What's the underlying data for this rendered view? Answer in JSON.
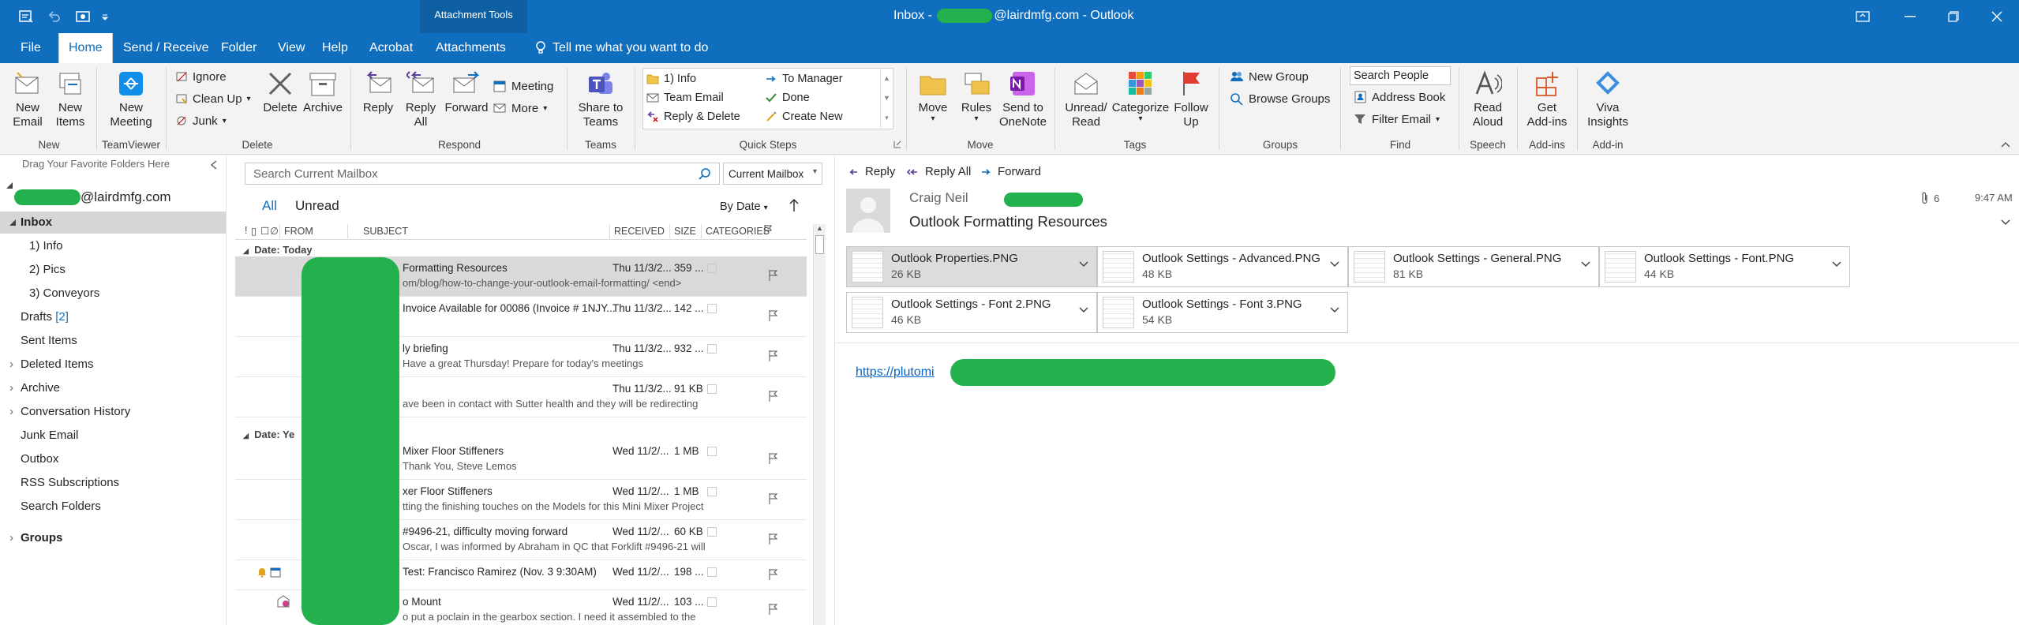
{
  "titlebar": {
    "context_tab": "Attachment Tools",
    "title_prefix": "Inbox - ",
    "title_domain": "@lairdmfg.com",
    "title_suffix": " - Outlook"
  },
  "menu": {
    "tabs": [
      "File",
      "Home",
      "Send / Receive",
      "Folder",
      "View",
      "Help",
      "Acrobat",
      "Attachments"
    ],
    "tell_me": "Tell me what you want to do"
  },
  "ribbon": {
    "new_email": [
      "New",
      "Email"
    ],
    "new_items": [
      "New",
      "Items"
    ],
    "group_new": "New",
    "new_meeting": [
      "New",
      "Meeting"
    ],
    "group_teamviewer": "TeamViewer",
    "ignore": "Ignore",
    "clean_up": "Clean Up",
    "junk": "Junk",
    "delete": "Delete",
    "archive": "Archive",
    "group_delete": "Delete",
    "reply": "Reply",
    "reply_all": [
      "Reply",
      "All"
    ],
    "forward": "Forward",
    "meeting": "Meeting",
    "more": "More",
    "group_respond": "Respond",
    "share_teams": [
      "Share to",
      "Teams"
    ],
    "group_teams": "Teams",
    "quick_steps": [
      "1) Info",
      "Team Email",
      "Reply & Delete",
      "To Manager",
      "Done",
      "Create New"
    ],
    "group_quick_steps": "Quick Steps",
    "move": "Move",
    "rules": "Rules",
    "send_onenote": [
      "Send to",
      "OneNote"
    ],
    "group_move": "Move",
    "unread_read": [
      "Unread/",
      "Read"
    ],
    "categorize": "Categorize",
    "follow_up": [
      "Follow",
      "Up"
    ],
    "group_tags": "Tags",
    "new_group": "New Group",
    "browse_groups": "Browse Groups",
    "group_groups": "Groups",
    "search_people": "Search People",
    "address_book": "Address Book",
    "filter_email": "Filter Email",
    "group_find": "Find",
    "read_aloud": [
      "Read",
      "Aloud"
    ],
    "group_speech": "Speech",
    "get_addins": [
      "Get",
      "Add-ins"
    ],
    "group_addins": "Add-ins",
    "viva": [
      "Viva",
      "Insights"
    ],
    "group_addin": "Add-in"
  },
  "folders": {
    "favorites_hint": "Drag Your Favorite Folders Here",
    "account": "@lairdmfg.com",
    "inbox": "Inbox",
    "sub": [
      "1) Info",
      "2) Pics",
      "3)  Conveyors"
    ],
    "drafts": "Drafts",
    "drafts_count": "[2]",
    "items": [
      "Sent Items",
      "Deleted Items",
      "Archive",
      "Conversation History",
      "Junk Email",
      "Outbox",
      "RSS Subscriptions",
      "Search Folders"
    ],
    "groups": "Groups"
  },
  "maillist": {
    "search_placeholder": "Search Current Mailbox",
    "scope": "Current Mailbox",
    "filter_all": "All",
    "filter_unread": "Unread",
    "sort": "By Date",
    "columns": {
      "from": "FROM",
      "subject": "SUBJECT",
      "received": "RECEIVED",
      "size": "SIZE",
      "categories": "CATEGORIES"
    },
    "group_today": "Date: Today",
    "group_yesterday": "Date: Ye",
    "today": [
      {
        "subject": "Formatting Resources",
        "preview": "om/blog/how-to-change-your-outlook-email-formatting/  <end>",
        "received": "Thu 11/3/2...",
        "size": "359 ..."
      },
      {
        "subject": "Invoice Available for 00086 (Invoice # 1NJY...",
        "preview": "",
        "received": "Thu 11/3/2...",
        "size": "142 ..."
      },
      {
        "subject": "ly briefing",
        "preview": "Have a great Thursday!   Prepare for today's meetings",
        "received": "Thu 11/3/2...",
        "size": "932 ..."
      },
      {
        "subject": "",
        "preview": "ave been in contact with Sutter health and they will be redirecting",
        "received": "Thu 11/3/2...",
        "size": "91 KB"
      }
    ],
    "yesterday": [
      {
        "subject": "Mixer Floor Stiffeners",
        "preview": "Thank You,   Steve Lemos",
        "received": "Wed 11/2/...",
        "size": "1 MB"
      },
      {
        "subject": "xer Floor Stiffeners",
        "preview": "tting the finishing touches on the Models for this Mini Mixer Project",
        "received": "Wed 11/2/...",
        "size": "1 MB"
      },
      {
        "subject": "#9496-21, difficulty moving forward",
        "preview": "Oscar,   I was informed by Abraham in QC that Forklift #9496-21 will",
        "received": "Wed 11/2/...",
        "size": "60 KB"
      },
      {
        "subject": "Test: Francisco Ramirez  (Nov. 3 9:30AM)",
        "preview": "",
        "received": "Wed 11/2/...",
        "size": "198 ..."
      },
      {
        "subject": "o Mount",
        "preview": "o put a poclain in the gearbox section.  I need it assembled to the",
        "received": "Wed 11/2/...",
        "size": "103 ..."
      }
    ]
  },
  "reading": {
    "reply": "Reply",
    "reply_all": "Reply All",
    "forward": "Forward",
    "sender": "Craig Neil",
    "subject": "Outlook Formatting Resources",
    "attachment_count": "6",
    "time": "9:47 AM",
    "attachments": [
      {
        "name": "Outlook Properties.PNG",
        "size": "26 KB"
      },
      {
        "name": "Outlook Settings - Advanced.PNG",
        "size": "48 KB"
      },
      {
        "name": "Outlook Settings - General.PNG",
        "size": "81 KB"
      },
      {
        "name": "Outlook Settings - Font.PNG",
        "size": "44 KB"
      },
      {
        "name": "Outlook Settings - Font 2.PNG",
        "size": "46 KB"
      },
      {
        "name": "Outlook Settings - Font 3.PNG",
        "size": "54 KB"
      }
    ],
    "link_text": "https://plutomi"
  },
  "colors": {
    "accent": "#106ebe",
    "redaction": "#23b14d",
    "selected_row": "#cde6f7",
    "selected_folder": "#d6d6d6"
  }
}
